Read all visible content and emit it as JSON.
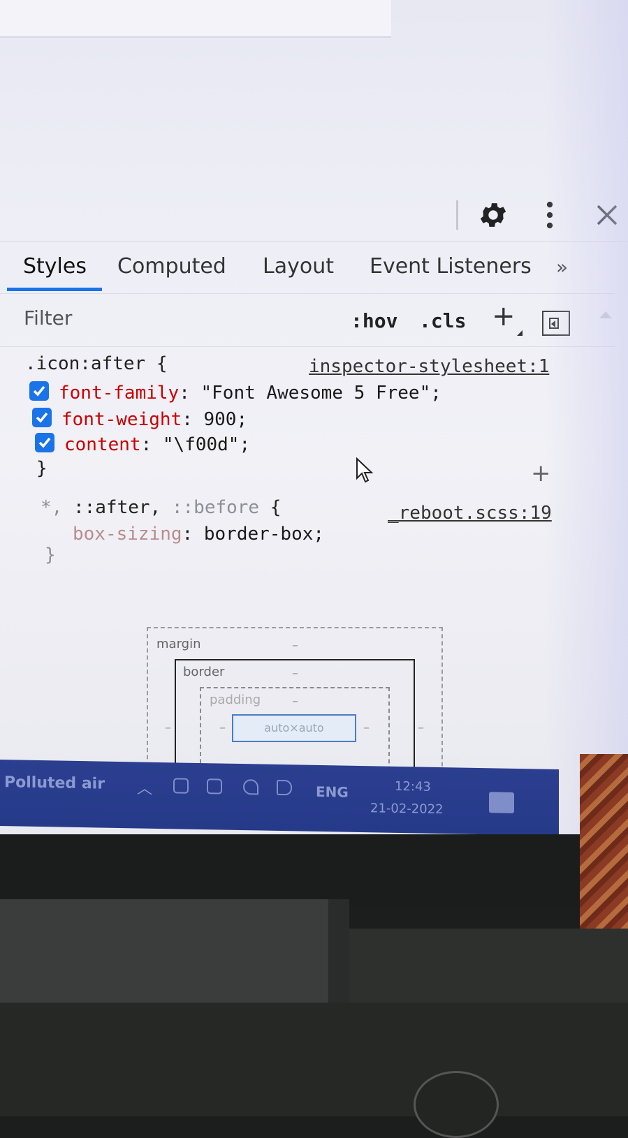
{
  "devtools": {
    "tabs": [
      "Styles",
      "Computed",
      "Layout",
      "Event Listeners"
    ],
    "more_tabs": "»",
    "filter": {
      "label": "Filter",
      "hov": ":hov",
      "cls": ".cls",
      "add": "+"
    },
    "rules": [
      {
        "selector": ".icon:after {",
        "source": "inspector-stylesheet:1",
        "declarations": [
          {
            "prop": "font-family",
            "value": "\"Font Awesome 5 Free\";"
          },
          {
            "prop": "font-weight",
            "value": "900;"
          },
          {
            "prop": "content",
            "value": "\"\\f00d\";"
          }
        ],
        "close": "}",
        "add": "+"
      },
      {
        "selector_star": "*,",
        "selector_after": " ::after,",
        "selector_before": " ::before",
        "selector_brace": " {",
        "source": "_reboot.scss:19",
        "declarations": [
          {
            "prop": "box-sizing",
            "value": "border-box;"
          }
        ],
        "close": "}"
      }
    ],
    "box_model": {
      "margin_label": "margin",
      "border_label": "border",
      "padding_label": "padding",
      "dash": "–",
      "content": "auto×auto"
    }
  },
  "taskbar": {
    "weather": "Polluted air",
    "language": "ENG",
    "time": "12:43",
    "date": "21-02-2022"
  }
}
